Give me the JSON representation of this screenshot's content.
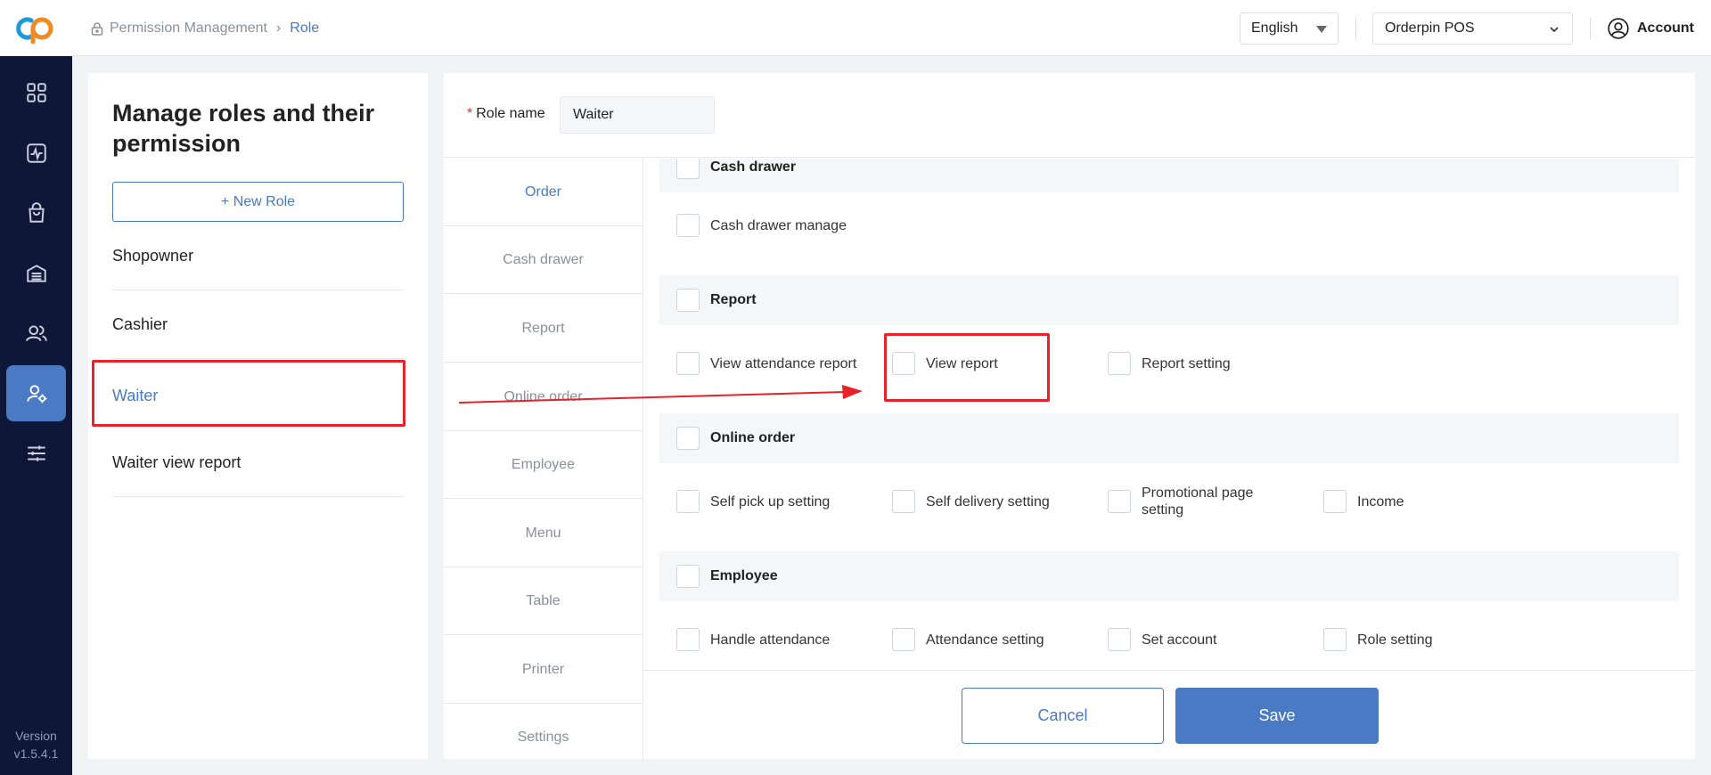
{
  "sidebar": {
    "version_label": "Version",
    "version_number": "v1.5.4.1",
    "icons": [
      "dashboard-icon",
      "activity-icon",
      "bag-icon",
      "store-icon",
      "users-icon",
      "user-gear-icon",
      "sliders-icon"
    ],
    "active_index": 5
  },
  "header": {
    "breadcrumb": [
      "Permission Management",
      "Role"
    ],
    "language": "English",
    "store": "Orderpin POS",
    "account": "Account"
  },
  "roles": {
    "title": "Manage roles and their permission",
    "new_role_label": "+ New Role",
    "items": [
      "Shopowner",
      "Cashier",
      "Waiter",
      "Waiter view report"
    ],
    "active_index": 2
  },
  "role_form": {
    "label": "Role name",
    "required_mark": "*",
    "value": "Waiter"
  },
  "tabs": {
    "items": [
      "Order",
      "Cash drawer",
      "Report",
      "Online order",
      "Employee",
      "Menu",
      "Table",
      "Printer",
      "Settings"
    ],
    "active_index": 0
  },
  "permissions": {
    "cash_drawer": {
      "title": "Cash drawer",
      "items": [
        "Cash drawer manage"
      ]
    },
    "report": {
      "title": "Report",
      "items": [
        "View attendance report",
        "View report",
        "Report setting"
      ]
    },
    "online_order": {
      "title": "Online order",
      "items": [
        "Self pick up setting",
        "Self delivery setting",
        "Promotional page setting",
        "Income"
      ]
    },
    "employee": {
      "title": "Employee",
      "items": [
        "Handle attendance",
        "Attendance setting",
        "Set account",
        "Role setting"
      ]
    }
  },
  "footer": {
    "cancel_label": "Cancel",
    "save_label": "Save"
  },
  "colors": {
    "accent": "#4a7ac3",
    "sidebar_bg": "#0e1737",
    "annotation": "#e8212a"
  }
}
